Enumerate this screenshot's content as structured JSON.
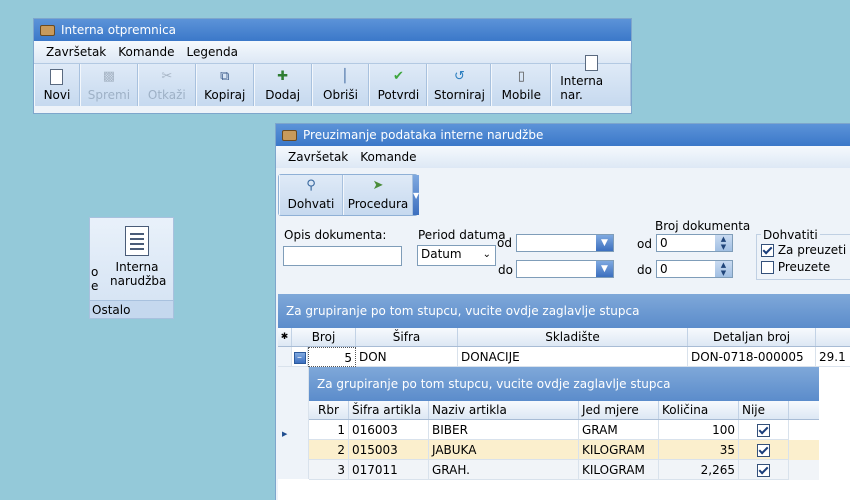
{
  "win1": {
    "title": "Interna otpremnica",
    "menu": [
      "Završetak",
      "Komande",
      "Legenda"
    ],
    "toolbar": [
      {
        "label": "Novi",
        "icon": "new-doc-icon",
        "enabled": true
      },
      {
        "label": "Spremi",
        "icon": "save-icon",
        "enabled": false
      },
      {
        "label": "Otkaži",
        "icon": "cut-icon",
        "enabled": false
      },
      {
        "label": "Kopiraj",
        "icon": "copy-icon",
        "enabled": true
      },
      {
        "label": "Dodaj",
        "icon": "add-icon",
        "enabled": true
      },
      {
        "label": "Obriši",
        "icon": "trash-icon",
        "enabled": true
      },
      {
        "label": "Potvrdi",
        "icon": "checkmark-icon",
        "enabled": true
      },
      {
        "label": "Storniraj",
        "icon": "undo-icon",
        "enabled": true
      },
      {
        "label": "Mobile",
        "icon": "mobile-icon",
        "enabled": true
      },
      {
        "label": "Interna nar.",
        "icon": "document-icon",
        "enabled": true
      }
    ]
  },
  "ribbon_panel": {
    "partial_label_1": "o",
    "partial_label_2": "e",
    "button_line1": "Interna",
    "button_line2": "narudžba",
    "group_label": "Ostalo"
  },
  "win2": {
    "title": "Preuzimanje podataka interne narudžbe",
    "menu": [
      "Završetak",
      "Komande"
    ],
    "toolbar": [
      {
        "label": "Dohvati",
        "icon": "search-icon"
      },
      {
        "label": "Procedura",
        "icon": "procedure-icon"
      }
    ],
    "filters": {
      "opis_label": "Opis dokumenta:",
      "opis_value": "",
      "period_label": "Period datuma",
      "period_value": "Datum",
      "od_label": "od",
      "do_label": "do",
      "date_from": "",
      "date_to": "",
      "broj_label": "Broj dokumenta",
      "broj_od_label": "od",
      "broj_do_label": "do",
      "broj_od": "0",
      "broj_do": "0",
      "dohvatiti_label": "Dohvatiti",
      "za_preuzeti_label": "Za preuzeti",
      "za_preuzeti_checked": true,
      "preuzete_label": "Preuzete",
      "preuzete_checked": false
    },
    "group_hint": "Za grupiranje po tom stupcu, vucite ovdje zaglavlje stupca",
    "master_columns": [
      "Broj",
      "Šifra",
      "Skladište",
      "Detaljan broj"
    ],
    "master_row": {
      "broj": "5",
      "sifra": "DON",
      "skladiste": "DONACIJE",
      "detaljan": "DON-0718-000005",
      "extra": "29.1"
    },
    "detail_group_hint": "Za grupiranje po tom stupcu, vucite ovdje zaglavlje stupca",
    "detail_columns": [
      "Rbr",
      "Šifra artikla",
      "Naziv artikla",
      "Jed mjere",
      "Količina",
      "Nije preu"
    ],
    "detail_rows": [
      {
        "rbr": "1",
        "sifra": "016003",
        "naziv": "BIBER",
        "jm": "GRAM",
        "kolicina": "100",
        "nije": true
      },
      {
        "rbr": "2",
        "sifra": "015003",
        "naziv": "JABUKA",
        "jm": "KILOGRAM",
        "kolicina": "35",
        "nije": true
      },
      {
        "rbr": "3",
        "sifra": "017011",
        "naziv": "GRAH.",
        "jm": "KILOGRAM",
        "kolicina": "2,265",
        "nije": true
      }
    ]
  }
}
